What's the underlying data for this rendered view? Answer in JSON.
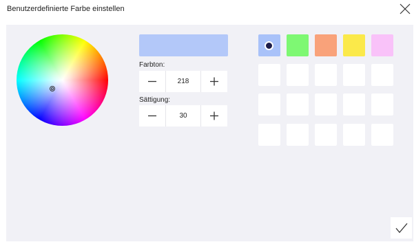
{
  "dialog": {
    "title": "Benutzerdefinierte Farbe einstellen",
    "close_icon": "close-icon",
    "ok_icon": "checkmark-icon"
  },
  "color": {
    "preview_hex": "#b3c8f9",
    "hue_label": "Farbton:",
    "hue_value": "218",
    "saturation_label": "Sättigung:",
    "saturation_value": "30",
    "decrement_icon": "minus-icon",
    "increment_icon": "plus-icon"
  },
  "swatches": {
    "selected_index": 0,
    "colors": [
      "#a9c2f9",
      "#7ef873",
      "#f9a27a",
      "#fbe94a",
      "#f9c2f9",
      "#ffffff",
      "#ffffff",
      "#ffffff",
      "#ffffff",
      "#ffffff",
      "#ffffff",
      "#ffffff",
      "#ffffff",
      "#ffffff",
      "#ffffff",
      "#ffffff",
      "#ffffff",
      "#ffffff",
      "#ffffff",
      "#ffffff"
    ]
  }
}
